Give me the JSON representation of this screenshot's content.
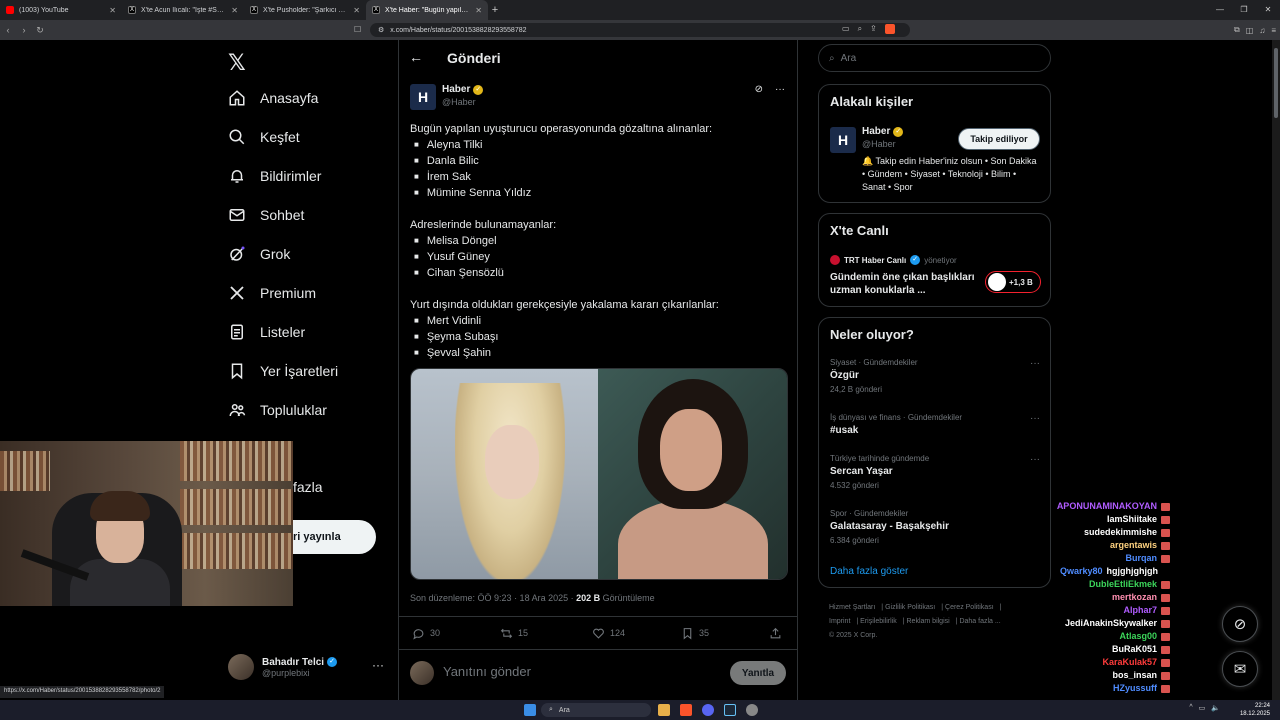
{
  "browser": {
    "tabs": [
      {
        "title": "(1003) YouTube",
        "fav": "youtube-icon"
      },
      {
        "title": "X'te Acun Ilıcalı: \"İşte #Survivor2026\"",
        "fav": "x-icon"
      },
      {
        "title": "X'te Pusholder: \"Şarkıcı Onur Akın'ı",
        "fav": "x-icon"
      },
      {
        "title": "X'te Haber: \"Bugün yapılan uyuşt",
        "fav": "x-icon",
        "active": true
      }
    ],
    "url": "x.com/Haber/status/2001538828293558782",
    "status_url": "https://x.com/Haber/status/2001538828293558782/photo/2"
  },
  "nav": {
    "items": [
      {
        "label": "Anasayfa",
        "icon": "home-icon"
      },
      {
        "label": "Keşfet",
        "icon": "search-icon"
      },
      {
        "label": "Bildirimler",
        "icon": "bell-icon"
      },
      {
        "label": "Sohbet",
        "icon": "mail-icon"
      },
      {
        "label": "Grok",
        "icon": "grok-icon"
      },
      {
        "label": "Premium",
        "icon": "x-icon"
      },
      {
        "label": "Listeler",
        "icon": "list-icon"
      },
      {
        "label": "Yer İşaretleri",
        "icon": "bookmark-icon"
      },
      {
        "label": "Topluluklar",
        "icon": "people-icon"
      }
    ],
    "more_label": "fazla",
    "post_label": "ri yayınla",
    "profile": {
      "name": "Bahadır Telci",
      "handle": "@purplebixi"
    }
  },
  "post": {
    "header_title": "Gönderi",
    "author": {
      "name": "Haber",
      "handle": "@Haber",
      "logo": "H"
    },
    "section1_title": "Bugün yapılan uyuşturucu operasyonunda gözaltına alınanlar:",
    "section1": [
      "Aleyna Tilki",
      "Danla Bilic",
      "İrem Sak",
      "Mümine Senna Yıldız"
    ],
    "section2_title": "Adreslerinde bulunamayanlar:",
    "section2": [
      "Melisa Döngel",
      "Yusuf Güney",
      "Cihan Şensözlü"
    ],
    "section3_title": "Yurt dışında oldukları gerekçesiyle yakalama kararı çıkarılanlar:",
    "section3": [
      "Mert Vidinli",
      "Şeyma Subaşı",
      "Şevval Şahin"
    ],
    "meta_edit": "Son düzenleme: ÖÖ 9:23 · 18 Ara 2025 · ",
    "meta_views": "202 B",
    "meta_views_label": " Görüntüleme",
    "stats": {
      "replies": "30",
      "reposts": "15",
      "likes": "124",
      "bookmarks": "35"
    },
    "reply_placeholder": "Yanıtını gönder",
    "reply_button": "Yanıtla"
  },
  "sidebar": {
    "search_placeholder": "Ara",
    "relevant": {
      "title": "Alakalı kişiler",
      "name": "Haber",
      "handle": "@Haber",
      "follow_label": "Takip ediliyor",
      "bio": "🔔 Takip edin Haber'iniz olsun • Son Dakika • Gündem • Siyaset • Teknoloji • Bilim • Sanat • Spor"
    },
    "live": {
      "title": "X'te Canlı",
      "host": "TRT Haber Canlı",
      "host_role": "yönetiyor",
      "topic": "Gündemin öne çıkan başlıkları uzman konuklarla ...",
      "listeners": "+1,3 B"
    },
    "trends": {
      "title": "Neler oluyor?",
      "items": [
        {
          "category": "Siyaset · Gündemdekiler",
          "name": "Özgür",
          "count": "24,2 B gönderi"
        },
        {
          "category": "İş dünyası ve finans · Gündemdekiler",
          "name": "#usak",
          "count": ""
        },
        {
          "category": "Türkiye tarihinde gündemde",
          "name": "Sercan Yaşar",
          "count": "4.532 gönderi"
        },
        {
          "category": "Spor · Gündemdekiler",
          "name": "Galatasaray - Başakşehir",
          "count": "6.384 gönderi"
        }
      ],
      "show_more": "Daha fazla göster"
    },
    "footer": {
      "line1": [
        "Hizmet Şartları",
        "Gizlilik Politikası",
        "Çerez Politikası"
      ],
      "line2": [
        "Imprint",
        "Erişilebilirlik",
        "Reklam bilgisi",
        "Daha fazla ..."
      ],
      "copyright": "© 2025 X Corp."
    }
  },
  "chat": [
    {
      "user": "APONUNAMINAKOYAN",
      "color": "#b05cff"
    },
    {
      "user": "IamShiitake",
      "color": "#ffffff"
    },
    {
      "user": "sudedekimmishe",
      "color": "#ffffff"
    },
    {
      "user": "argentawis",
      "color": "#ffd27f"
    },
    {
      "user": "Burqan",
      "color": "#4f8cff"
    },
    {
      "user": "Qwarky80",
      "color": "#4f8cff",
      "message": "hgjghjghjgh"
    },
    {
      "user": "DubleEtliEkmek",
      "color": "#3cd45a"
    },
    {
      "user": "mertkozan",
      "color": "#ff8fb0"
    },
    {
      "user": "Alphar7",
      "color": "#b05cff"
    },
    {
      "user": "JediAnakinSkywalker",
      "color": "#ffffff"
    },
    {
      "user": "Atlasg00",
      "color": "#3cd45a"
    },
    {
      "user": "BuRaK051",
      "color": "#ffffff"
    },
    {
      "user": "KaraKulak57",
      "color": "#ff3b3b"
    },
    {
      "user": "bos_insan",
      "color": "#ffffff"
    },
    {
      "user": "HZyussuff",
      "color": "#4f8cff"
    }
  ],
  "taskbar": {
    "search": "Ara",
    "time": "22:24",
    "date": "18.12.2025"
  },
  "colors": {
    "accent": "#1d9bf0",
    "verified_gold": "#e2b719",
    "background": "#000000",
    "border": "#2f3336",
    "muted": "#71767b"
  }
}
